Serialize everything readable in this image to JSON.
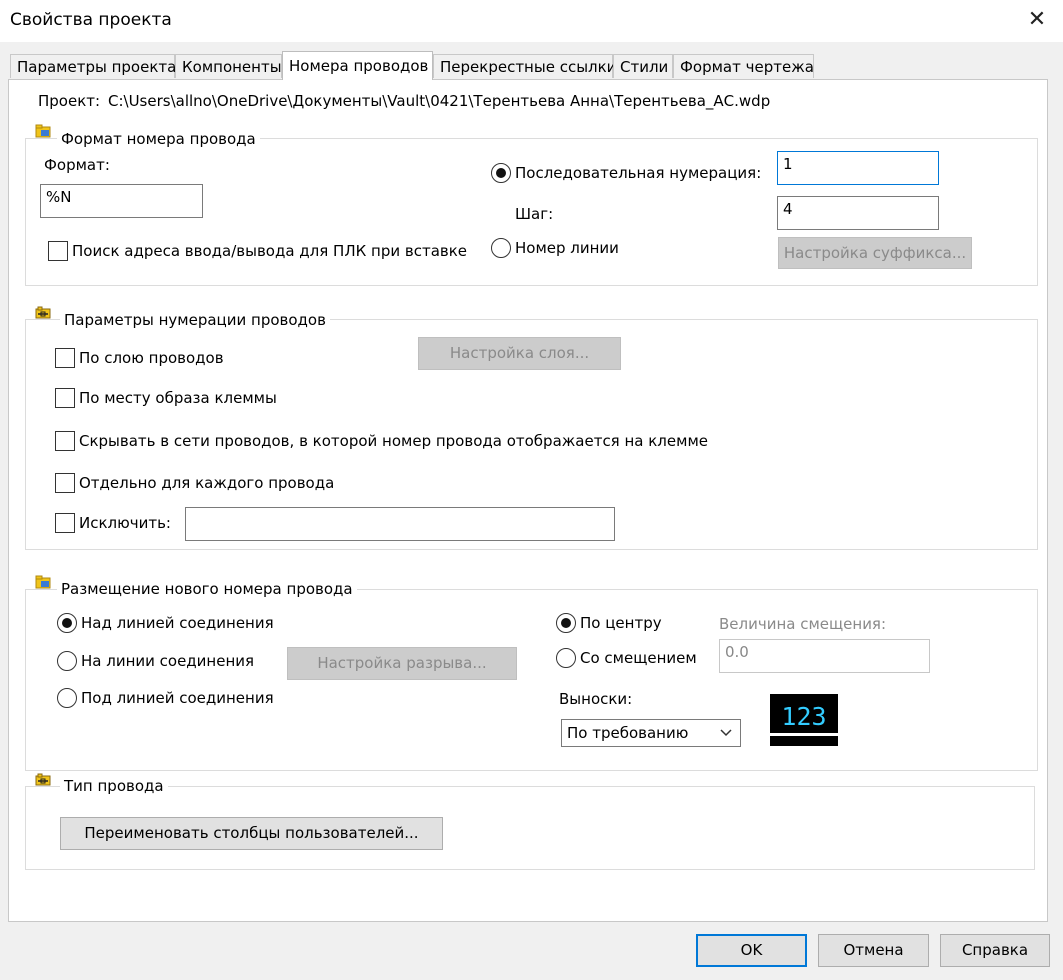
{
  "window": {
    "title": "Свойства проекта"
  },
  "tabs": [
    "Параметры проекта",
    "Компоненты",
    "Номера проводов",
    "Перекрестные ссылки",
    "Стили",
    "Формат чертежа"
  ],
  "active_tab": "Номера проводов",
  "project": {
    "label": "Проект:",
    "path": "C:\\Users\\allno\\OneDrive\\Документы\\Vault\\0421\\Терентьева Анна\\Терентьева_АС.wdp"
  },
  "wire_format": {
    "title": "Формат номера провода",
    "format_label": "Формат:",
    "format_value": "%N",
    "sequential_label": "Последовательная нумерация:",
    "sequential_value": "1",
    "step_label": "Шаг:",
    "step_value": "4",
    "plc_label": "Поиск адреса ввода/вывода для ПЛК при вставке",
    "line_number_label": "Номер линии",
    "suffix_button": "Настройка суффикса..."
  },
  "numbering": {
    "title": "Параметры нумерации проводов",
    "by_layer": "По слою проводов",
    "layer_button": "Настройка слоя...",
    "by_terminal": "По месту образа клеммы",
    "hide": "Скрывать в сети проводов, в которой номер провода отображается на клемме",
    "each_wire": "Отдельно для каждого провода",
    "exclude": "Исключить:",
    "exclude_value": ""
  },
  "placement": {
    "title": "Размещение нового номера провода",
    "above": "Над линией соединения",
    "on": "На линии соединения",
    "below": "Под линией соединения",
    "gap_button": "Настройка разрыва...",
    "center": "По центру",
    "offset": "Со смещением",
    "offset_label": "Величина смещения:",
    "offset_value": "0.0",
    "leaders_label": "Выноски:",
    "leaders_value": "По требованию",
    "preview_text": "123",
    "preview_text_color": "#33ccff"
  },
  "wire_type": {
    "title": "Тип провода",
    "rename_button": "Переименовать столбцы пользователей..."
  },
  "buttons": {
    "ok": "OK",
    "cancel": "Отмена",
    "help": "Справка"
  },
  "colors": {
    "accent": "#0078d7",
    "folder": "#f0c419"
  }
}
